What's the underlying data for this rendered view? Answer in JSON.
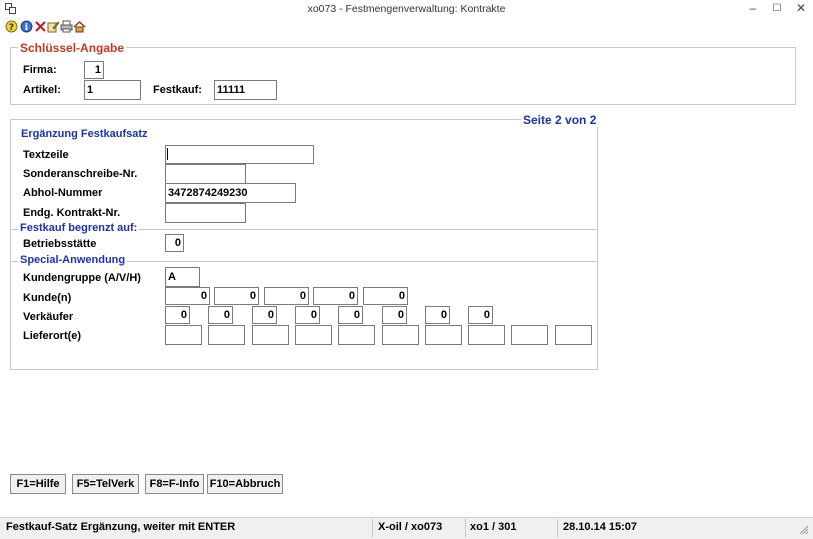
{
  "window": {
    "title": "xo073 - Festmengenverwaltung: Kontrakte",
    "minimize": "–",
    "maximize": "☐",
    "close": "✕"
  },
  "toolbar": {
    "icons": [
      "help-icon",
      "info-icon",
      "delete-icon",
      "edit-icon",
      "print-icon",
      "home-icon"
    ]
  },
  "key_section": {
    "title": "Schlüssel-Angabe",
    "firma_label": "Firma:",
    "firma_value": "1",
    "artikel_label": "Artikel:",
    "artikel_value": "1",
    "festkauf_label": "Festkauf:",
    "festkauf_value": "11111"
  },
  "detail": {
    "page_indicator": "Seite 2 von 2",
    "title": "Ergänzung Festkaufsatz",
    "textzeile_label": "Textzeile",
    "textzeile_value": "",
    "sonder_label": "Sonderanschreibe-Nr.",
    "sonder_value": "",
    "abhol_label": "Abhol-Nummer",
    "abhol_value": "3472874249230",
    "endg_label": "Endg. Kontrakt-Nr.",
    "endg_value": ""
  },
  "restriction": {
    "title": "Festkauf begrenzt auf:",
    "betrieb_label": "Betriebsstätte",
    "betrieb_value": "0"
  },
  "special": {
    "title": "Special-Anwendung",
    "kundengruppe_label": "Kundengruppe (A/V/H)",
    "kundengruppe_value": "A",
    "kunden_label": "Kunde(n)",
    "kunden": [
      "0",
      "0",
      "0",
      "0",
      "0"
    ],
    "verkaeufer_label": "Verkäufer",
    "verkaeufer": [
      "0",
      "0",
      "0",
      "0",
      "0",
      "0",
      "0",
      "0"
    ],
    "lieferort_label": "Lieferort(e)",
    "lieferorte": [
      "",
      "",
      "",
      "",
      "",
      "",
      "",
      "",
      "",
      ""
    ]
  },
  "function_keys": [
    {
      "label": "F1=Hilfe"
    },
    {
      "label": "F5=TelVerk"
    },
    {
      "label": "F8=F-Info"
    },
    {
      "label": "F10=Abbruch"
    }
  ],
  "status": {
    "message": "Festkauf-Satz Ergänzung, weiter mit ENTER",
    "system": "X-oil / xo073",
    "user": "xo1 / 301",
    "datetime": "28.10.14 15:07"
  }
}
